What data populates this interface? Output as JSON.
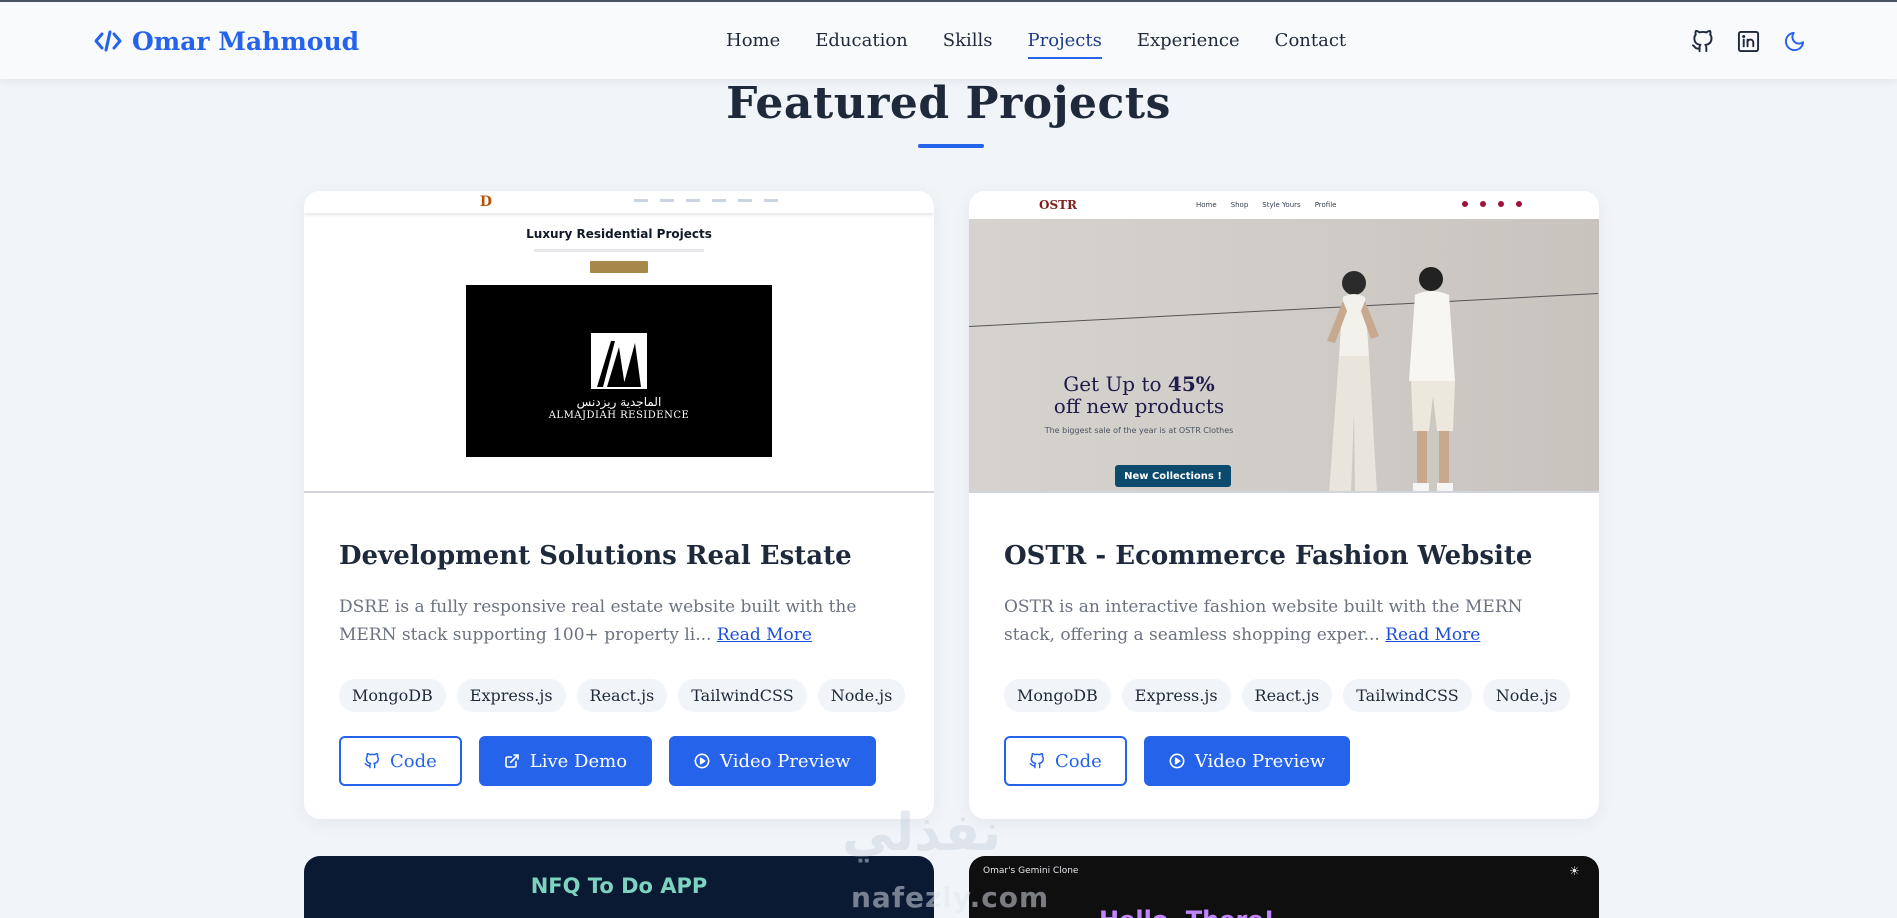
{
  "header": {
    "logo_text": "Omar Mahmoud",
    "nav": [
      "Home",
      "Education",
      "Skills",
      "Projects",
      "Experience",
      "Contact"
    ],
    "active_nav": "Projects",
    "icons": [
      "github-icon",
      "linkedin-icon",
      "moon-icon"
    ]
  },
  "section": {
    "title": "Featured Projects"
  },
  "projects": [
    {
      "title": "Development Solutions Real Estate",
      "description": "DSRE is a fully responsive real estate website built with the MERN stack supporting 100+ property li...",
      "read_more": "Read More",
      "tags": [
        "MongoDB",
        "Express.js",
        "React.js",
        "TailwindCSS",
        "Node.js"
      ],
      "buttons": {
        "code": "Code",
        "live": "Live Demo",
        "video": "Video Preview"
      },
      "preview": {
        "heading": "Luxury Residential Projects",
        "brand_ar": "الماجدية ريزدنس",
        "brand_en": "ALMAJDIAH RESIDENCE"
      }
    },
    {
      "title": "OSTR - Ecommerce Fashion Website",
      "description": "OSTR is an interactive fashion website built with the MERN stack, offering a seamless shopping exper...",
      "read_more": "Read More",
      "tags": [
        "MongoDB",
        "Express.js",
        "React.js",
        "TailwindCSS",
        "Node.js"
      ],
      "buttons": {
        "code": "Code",
        "video": "Video Preview"
      },
      "preview": {
        "logo": "OSTR",
        "nav": [
          "Home",
          "Shop",
          "Style Yours",
          "Profile"
        ],
        "headline_1": "Get Up to ",
        "headline_pct": "45%",
        "headline_2": "off new products",
        "sub": "The biggest sale of the year is at OSTR Clothes",
        "cta": "New Collections !"
      }
    }
  ],
  "next_cards": [
    {
      "title": "NFQ To Do APP"
    },
    {
      "small": "Omar's Gemini Clone",
      "hello": "Hello, There!"
    }
  ],
  "watermark": {
    "ar": "نفذلي",
    "en": "nafezly.com"
  },
  "colors": {
    "accent": "#2563eb",
    "bg": "#f1f5f9",
    "card": "#ffffff",
    "text": "#1e293b"
  }
}
